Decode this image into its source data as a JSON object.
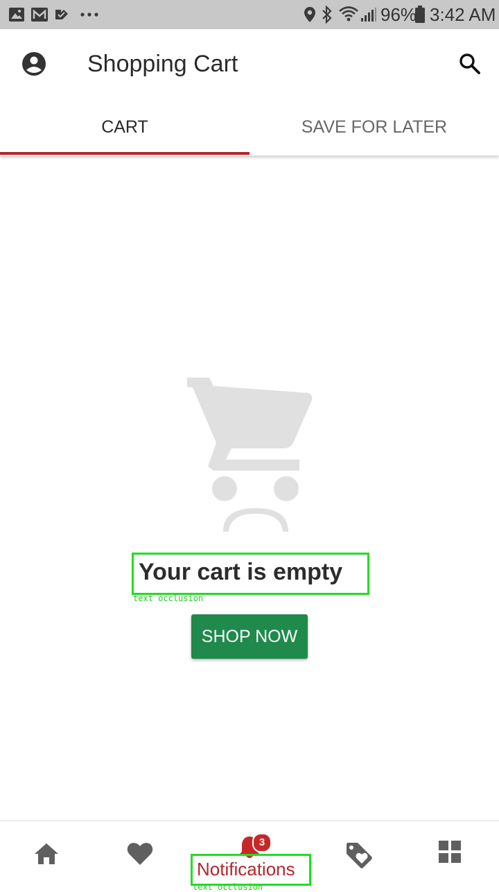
{
  "status_bar": {
    "battery": "96%",
    "time": "3:42 AM",
    "left_icons": [
      "gallery-icon",
      "gmail-icon",
      "tasks-icon",
      "more-dots-icon"
    ],
    "right_icons": [
      "location-icon",
      "bluetooth-icon",
      "wifi-icon",
      "signal-icon",
      "battery-icon"
    ]
  },
  "app_bar": {
    "title": "Shopping Cart",
    "account_icon": "account-circle-icon",
    "search_icon": "search-icon"
  },
  "tabs": [
    {
      "label": "CART",
      "selected": true
    },
    {
      "label": "SAVE FOR LATER",
      "selected": false
    }
  ],
  "empty_state": {
    "icon": "sad-cart-icon",
    "title": "Your cart is empty",
    "button_label": "SHOP NOW",
    "occlusion_note": "text occlusion"
  },
  "bottom_nav": {
    "items": [
      {
        "icon": "home-icon"
      },
      {
        "icon": "heart-icon"
      },
      {
        "icon": "bell-icon",
        "label": "Notifications",
        "badge": "3",
        "selected": true
      },
      {
        "icon": "tag-heart-icon"
      },
      {
        "icon": "grid-icon"
      }
    ],
    "occlusion_note": "text occlusion"
  },
  "colors": {
    "accent": "#b3262c",
    "button": "#1f8a4c",
    "status_bar": "#c8c8c8",
    "annotation": "#22dd22"
  }
}
